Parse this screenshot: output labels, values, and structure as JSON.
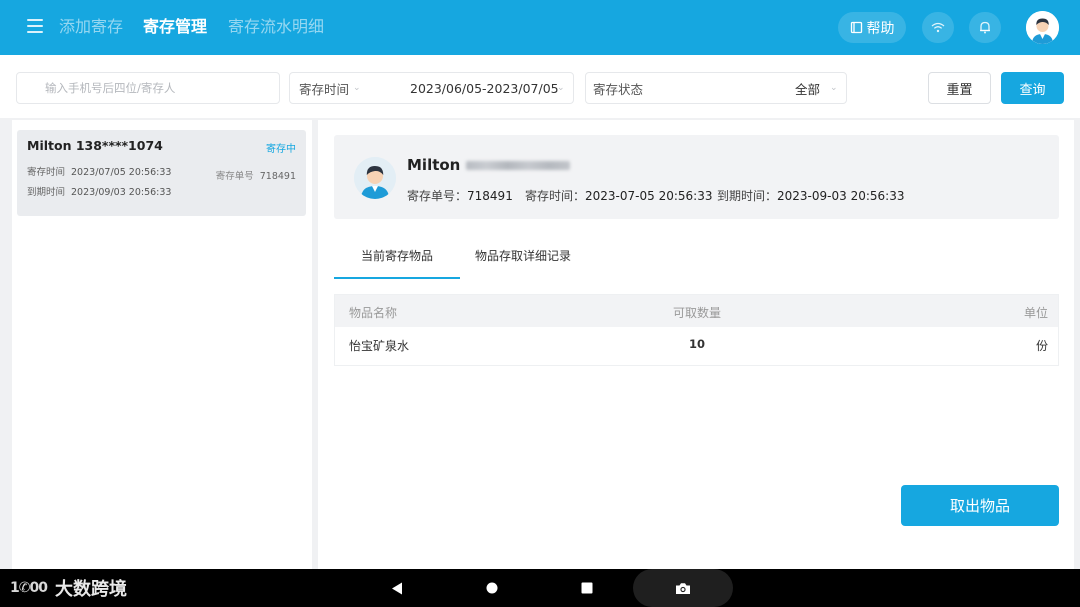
{
  "nav": {
    "tabs": [
      {
        "label": "添加寄存",
        "active": false
      },
      {
        "label": "寄存管理",
        "active": true
      },
      {
        "label": "寄存流水明细",
        "active": false
      }
    ],
    "help_label": "帮助",
    "icons": [
      "menu-icon",
      "book-icon",
      "wifi-icon",
      "bell-icon",
      "user-avatar"
    ]
  },
  "filters": {
    "search_placeholder": "输入手机号后四位/寄存人",
    "search_value": "",
    "date_label": "寄存时间",
    "date_value": "2023/06/05-2023/07/05",
    "status_label": "寄存状态",
    "status_value": "全部",
    "reset_label": "重置",
    "query_label": "查询"
  },
  "records": [
    {
      "title": "Milton 138****1074",
      "status": "寄存中",
      "store_time_label": "寄存时间",
      "store_time": "2023/07/05 20:56:33",
      "expire_time_label": "到期时间",
      "expire_time": "2023/09/03 20:56:33",
      "order_no_label": "寄存单号",
      "order_no": "718491"
    }
  ],
  "detail": {
    "name": "Milton",
    "phone": "",
    "order_no_label": "寄存单号：",
    "order_no": "718491",
    "store_time_label": "寄存时间：",
    "store_time": "2023-07-05 20:56:33",
    "expire_time_label": "到期时间：",
    "expire_time": "2023-09-03 20:56:33",
    "tabs": [
      "当前寄存物品",
      "物品存取详细记录"
    ],
    "table": {
      "headers": [
        "物品名称",
        "可取数量",
        "单位"
      ],
      "rows": [
        {
          "name": "怡宝矿泉水",
          "qty": "10",
          "unit": "份"
        }
      ]
    },
    "take_out_label": "取出物品"
  },
  "watermark": {
    "logo": "1✆00",
    "text": "大数跨境"
  },
  "colors": {
    "primary": "#16a7e0",
    "panel_bg": "#f2f3f5",
    "page_bg": "#f0f1f3"
  }
}
